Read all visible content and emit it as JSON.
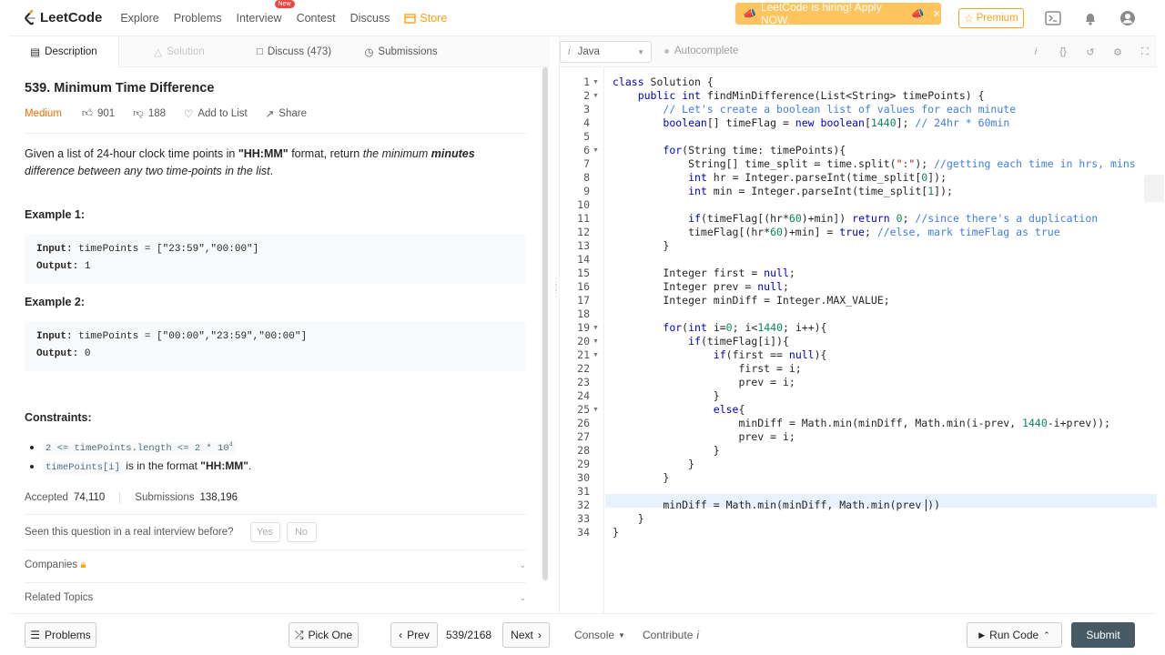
{
  "nav": {
    "logo": "LeetCode",
    "items": [
      "Explore",
      "Problems",
      "Interview",
      "Contest",
      "Discuss"
    ],
    "new_badge": "New",
    "store": "Store",
    "hiring": "LeetCode is hiring! Apply NOW.",
    "premium": "Premium"
  },
  "left_tabs": [
    "Description",
    "Solution",
    "Discuss (473)",
    "Submissions"
  ],
  "problem": {
    "title": "539. Minimum Time Difference",
    "difficulty": "Medium",
    "likes": "901",
    "dislikes": "188",
    "add_to_list": "Add to List",
    "share": "Share",
    "desc_1": "Given a list of 24-hour clock time points in ",
    "desc_fmt": "\"HH:MM\"",
    "desc_2": " format, return ",
    "desc_3": "the minimum ",
    "desc_4": "minutes",
    "desc_5": " difference between any two time-points in the list",
    "desc_6": ".",
    "ex1_title": "Example 1:",
    "ex1_input_label": "Input:",
    "ex1_input": " timePoints = [\"23:59\",\"00:00\"]",
    "ex1_output_label": "Output:",
    "ex1_output": " 1",
    "ex2_title": "Example 2:",
    "ex2_input_label": "Input:",
    "ex2_input": " timePoints = [\"00:00\",\"23:59\",\"00:00\"]",
    "ex2_output_label": "Output:",
    "ex2_output": " 0",
    "constraints_title": "Constraints:",
    "c1_code": "2 <= timePoints.length <= 2 * 10",
    "c1_sup": "4",
    "c2_code": "timePoints[i]",
    "c2_text": " is in the format ",
    "c2_fmt": "\"HH:MM\"",
    "c2_end": ".",
    "accepted_label": "Accepted",
    "accepted": "74,110",
    "submissions_label": "Submissions",
    "submissions": "138,196",
    "seen": "Seen this question in a real interview before?",
    "yes": "Yes",
    "no": "No",
    "companies": "Companies",
    "related": "Related Topics"
  },
  "editor": {
    "language": "Java",
    "autocomplete": "Autocomplete"
  },
  "bottom": {
    "problems": "Problems",
    "pick_one": "Pick One",
    "prev": "Prev",
    "page": "539/2168",
    "next": "Next",
    "console": "Console",
    "contribute": "Contribute",
    "run_code": "Run Code",
    "submit": "Submit"
  }
}
